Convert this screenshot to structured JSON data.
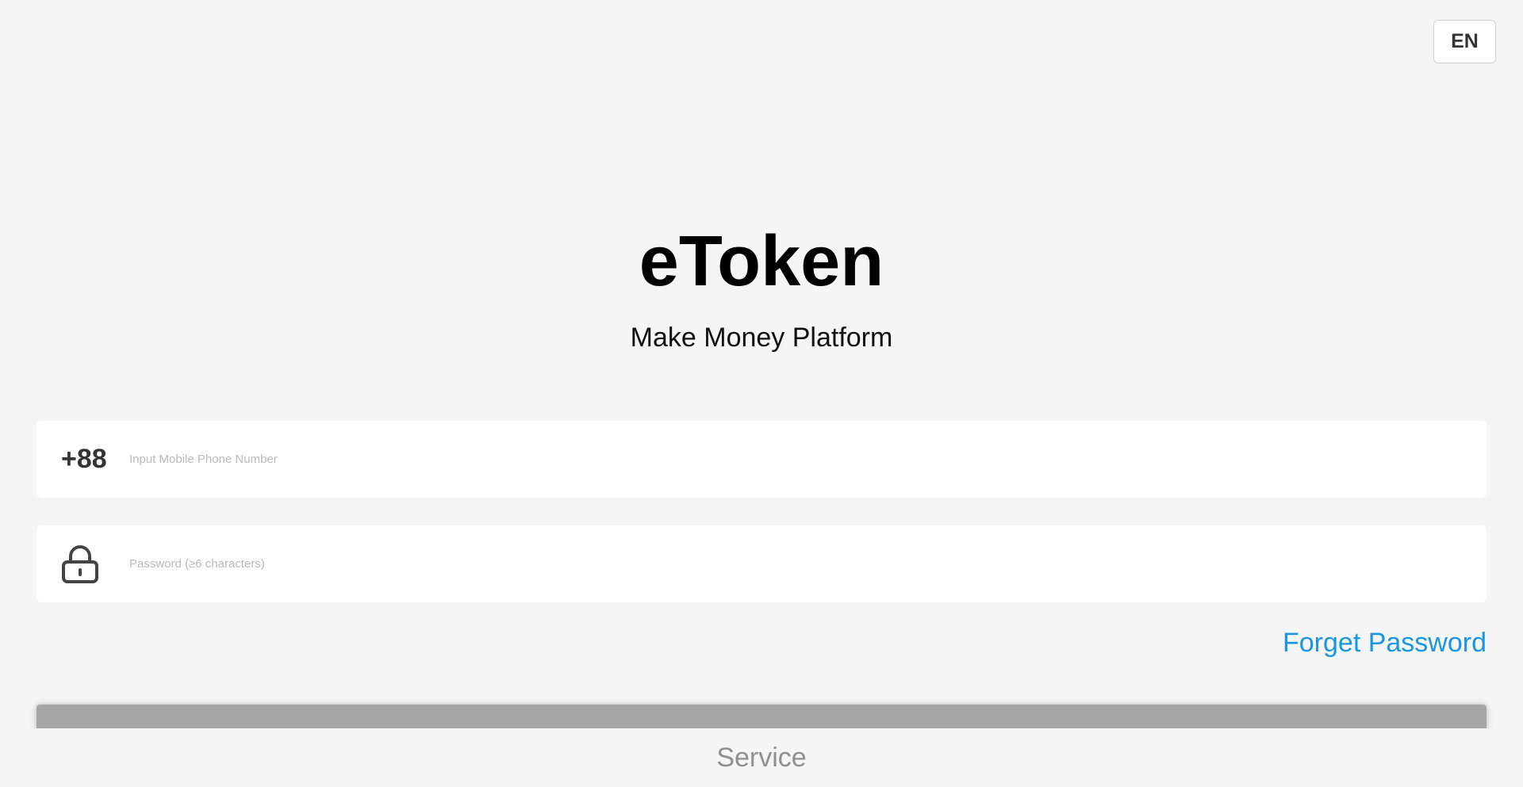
{
  "header": {
    "language_label": "EN"
  },
  "brand": {
    "title": "eToken",
    "subtitle": "Make Money Platform"
  },
  "login_form": {
    "phone": {
      "country_code": "+88",
      "placeholder": "Input Mobile Phone Number",
      "value": ""
    },
    "password": {
      "icon": "lock-icon",
      "placeholder": "Password (≥6 characters)",
      "value": ""
    },
    "forget_password_label": "Forget Password",
    "login_button_label": ""
  },
  "footer": {
    "service_label": "Service"
  },
  "colors": {
    "background": "#f5f5f5",
    "link": "#1a96e2",
    "button_disabled": "#a6a6a6",
    "muted_text": "#8f8f8f"
  }
}
